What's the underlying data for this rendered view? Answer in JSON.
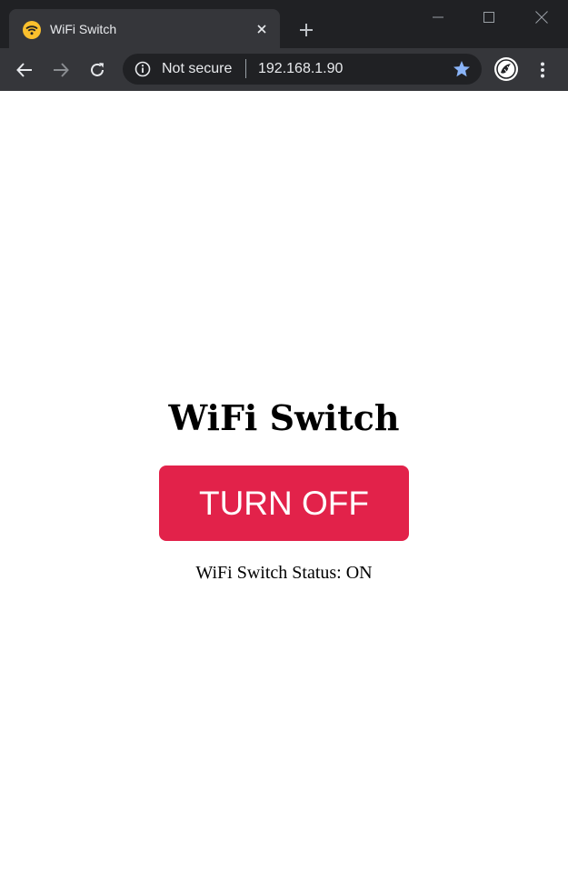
{
  "browser": {
    "tab": {
      "title": "WiFi Switch",
      "favicon": "wifi-icon"
    },
    "omnibox": {
      "security_label": "Not secure",
      "url": "192.168.1.90"
    },
    "colors": {
      "frame": "#202124",
      "toolbar": "#35363a",
      "omnibox": "#202124",
      "star": "#8ab4f8",
      "favicon": "#fbc02d"
    }
  },
  "page": {
    "heading": "WiFi Switch",
    "button_label": "TURN OFF",
    "status_text": "WiFi Switch Status: ON",
    "colors": {
      "button": "#e2224a",
      "button_text": "#ffffff",
      "background": "#ffffff"
    }
  }
}
